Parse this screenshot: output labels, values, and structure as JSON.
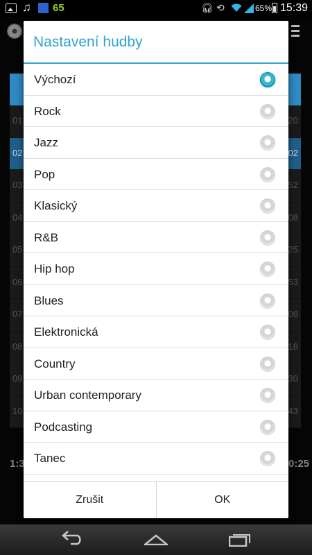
{
  "status_bar": {
    "notification_count": "65",
    "battery_percent": "65%",
    "time": "15:39"
  },
  "background_app": {
    "rows": [
      {
        "num": "01",
        "time": "20"
      },
      {
        "num": "02",
        "time": "02"
      },
      {
        "num": "03",
        "time": "52"
      },
      {
        "num": "04",
        "time": "08"
      },
      {
        "num": "05",
        "time": "25"
      },
      {
        "num": "06",
        "time": "53"
      },
      {
        "num": "07",
        "time": "08"
      },
      {
        "num": "08",
        "time": "18"
      },
      {
        "num": "09",
        "time": "30"
      },
      {
        "num": "10",
        "time": "43"
      }
    ],
    "elapsed": "1:3",
    "total": "0:25"
  },
  "dialog": {
    "title": "Nastavení hudby",
    "selected": "Výchozí",
    "options": [
      {
        "label": "Výchozí"
      },
      {
        "label": "Rock"
      },
      {
        "label": "Jazz"
      },
      {
        "label": "Pop"
      },
      {
        "label": "Klasický"
      },
      {
        "label": "R&B"
      },
      {
        "label": "Hip hop"
      },
      {
        "label": "Blues"
      },
      {
        "label": "Elektronická"
      },
      {
        "label": "Country"
      },
      {
        "label": "Urban contemporary"
      },
      {
        "label": "Podcasting"
      },
      {
        "label": "Tanec"
      }
    ],
    "cancel_label": "Zrušit",
    "ok_label": "OK",
    "accent_color": "#34a3cf"
  },
  "navbar": {
    "icons": [
      "back-icon",
      "home-icon",
      "recent-apps-icon"
    ]
  }
}
